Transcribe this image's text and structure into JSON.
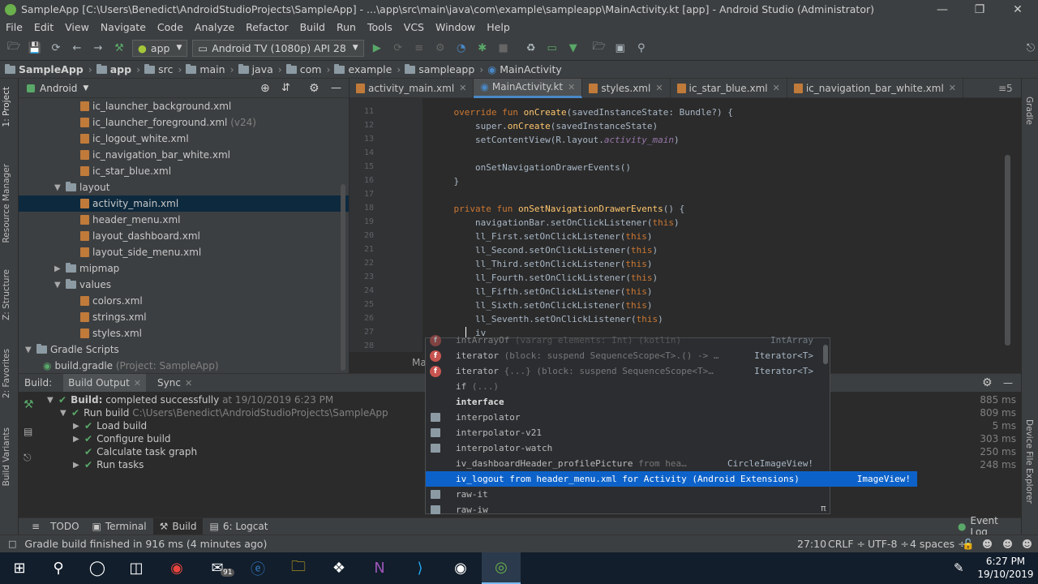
{
  "window": {
    "title": "SampleApp [C:\\Users\\Benedict\\AndroidStudioProjects\\SampleApp] - ...\\app\\src\\main\\java\\com\\example\\sampleapp\\MainActivity.kt [app] - Android Studio (Administrator)"
  },
  "menu": [
    "File",
    "Edit",
    "View",
    "Navigate",
    "Code",
    "Analyze",
    "Refactor",
    "Build",
    "Run",
    "Tools",
    "VCS",
    "Window",
    "Help"
  ],
  "toolbar": {
    "module": "app",
    "device": "Android TV (1080p) API 28"
  },
  "breadcrumb": [
    "SampleApp",
    "app",
    "src",
    "main",
    "java",
    "com",
    "example",
    "sampleapp",
    "MainActivity"
  ],
  "project": {
    "view": "Android",
    "items": [
      {
        "label": "ic_launcher_background.xml",
        "type": "xml",
        "indent": 4
      },
      {
        "label": "ic_launcher_foreground.xml",
        "extra": "(v24)",
        "type": "xml",
        "indent": 4
      },
      {
        "label": "ic_logout_white.xml",
        "type": "xml",
        "indent": 4
      },
      {
        "label": "ic_navigation_bar_white.xml",
        "type": "xml",
        "indent": 4
      },
      {
        "label": "ic_star_blue.xml",
        "type": "xml",
        "indent": 4
      },
      {
        "label": "layout",
        "type": "folder",
        "open": true,
        "indent": 3
      },
      {
        "label": "activity_main.xml",
        "type": "xml",
        "indent": 4,
        "selected": true
      },
      {
        "label": "header_menu.xml",
        "type": "xml",
        "indent": 4
      },
      {
        "label": "layout_dashboard.xml",
        "type": "xml",
        "indent": 4
      },
      {
        "label": "layout_side_menu.xml",
        "type": "xml",
        "indent": 4
      },
      {
        "label": "mipmap",
        "type": "folder",
        "open": false,
        "indent": 3
      },
      {
        "label": "values",
        "type": "folder",
        "open": true,
        "indent": 3
      },
      {
        "label": "colors.xml",
        "type": "xml",
        "indent": 4
      },
      {
        "label": "strings.xml",
        "type": "xml",
        "indent": 4
      },
      {
        "label": "styles.xml",
        "type": "xml",
        "indent": 4
      },
      {
        "label": "Gradle Scripts",
        "type": "gradle",
        "open": true,
        "indent": 1
      },
      {
        "label": "build.gradle",
        "extra": "(Project: SampleApp)",
        "type": "gradlefile",
        "indent": 2
      }
    ]
  },
  "editor_tabs": [
    {
      "label": "activity_main.xml",
      "active": false
    },
    {
      "label": "MainActivity.kt",
      "active": true
    },
    {
      "label": "styles.xml",
      "active": false
    },
    {
      "label": "ic_star_blue.xml",
      "active": false
    },
    {
      "label": "ic_navigation_bar_white.xml",
      "active": false
    }
  ],
  "code_lines": [
    {
      "n": "11",
      "text": "    override fun onCreate(savedInstanceState: Bundle?) {"
    },
    {
      "n": "12",
      "text": "        super.onCreate(savedInstanceState)"
    },
    {
      "n": "13",
      "text": "        setContentView(R.layout.activity_main)"
    },
    {
      "n": "14",
      "text": ""
    },
    {
      "n": "15",
      "text": "        onSetNavigationDrawerEvents()"
    },
    {
      "n": "16",
      "text": "    }"
    },
    {
      "n": "17",
      "text": ""
    },
    {
      "n": "18",
      "text": "    private fun onSetNavigationDrawerEvents() {"
    },
    {
      "n": "19",
      "text": "        navigationBar.setOnClickListener(this)"
    },
    {
      "n": "20",
      "text": "        ll_First.setOnClickListener(this)"
    },
    {
      "n": "21",
      "text": "        ll_Second.setOnClickListener(this)"
    },
    {
      "n": "22",
      "text": "        ll_Third.setOnClickListener(this)"
    },
    {
      "n": "23",
      "text": "        ll_Fourth.setOnClickListener(this)"
    },
    {
      "n": "24",
      "text": "        ll_Fifth.setOnClickListener(this)"
    },
    {
      "n": "25",
      "text": "        ll_Sixth.setOnClickListener(this)"
    },
    {
      "n": "26",
      "text": "        ll_Seventh.setOnClickListener(this)"
    },
    {
      "n": "27",
      "text": "        iv"
    },
    {
      "n": "28",
      "text": ""
    }
  ],
  "editor_breadcrumb": "Ma",
  "completion": [
    {
      "kind": "red",
      "text": "intArrayOf",
      "tail": "(vararg elements: Int) (kotlin)",
      "type": "IntArray"
    },
    {
      "kind": "red",
      "text": "iterator",
      "tail": "(block: suspend SequenceScope<T>.() -> …",
      "type": "Iterator<T>"
    },
    {
      "kind": "red",
      "text": "iterator",
      "tail": "{...} (block: suspend SequenceScope<T>…",
      "type": "Iterator<T>"
    },
    {
      "kind": "none",
      "text": "if",
      "tail": "(...)",
      "type": ""
    },
    {
      "kind": "none",
      "text": "interface",
      "tail": "",
      "type": "",
      "bold": true
    },
    {
      "kind": "folder",
      "text": "interpolator",
      "tail": "",
      "type": ""
    },
    {
      "kind": "folder",
      "text": "interpolator-v21",
      "tail": "",
      "type": ""
    },
    {
      "kind": "folder",
      "text": "interpolator-watch",
      "tail": "",
      "type": ""
    },
    {
      "kind": "none",
      "text": "iv_dashboardHeader_profilePicture",
      "tail": "from hea…",
      "type": "CircleImageView!"
    },
    {
      "kind": "none",
      "text": "iv_logout",
      "tail": "from header_menu.xml for Activity (Android Extensions)",
      "type": "ImageView!",
      "selected": true
    },
    {
      "kind": "folder",
      "text": "raw-it",
      "tail": "",
      "type": ""
    },
    {
      "kind": "folder",
      "text": "raw-iw",
      "tail": "",
      "type": ""
    }
  ],
  "completion_footer": "π",
  "build": {
    "tabs": [
      "Build:",
      "Build Output",
      "Sync"
    ],
    "status_bold": "Build:",
    "status_text": "completed successfully",
    "status_time": "at 19/10/2019 6:23 PM",
    "run_build": "Run build",
    "run_build_path": "C:\\Users\\Benedict\\AndroidStudioProjects\\SampleApp",
    "steps": [
      "Load build",
      "Configure build",
      "Calculate task graph",
      "Run tasks"
    ],
    "timings": [
      "885 ms",
      "809 ms",
      "5 ms",
      "303 ms",
      "250 ms",
      "248 ms"
    ]
  },
  "bottom_tools": [
    "TODO",
    "Terminal",
    "Build",
    "6: Logcat"
  ],
  "event_log": "Event Log",
  "status": {
    "message": "Gradle build finished in 916 ms (4 minutes ago)",
    "position": "27:10",
    "line_sep": "CRLF ÷",
    "encoding": "UTF-8 ÷",
    "indent": "4 spaces ÷"
  },
  "side_tabs_left": [
    "1: Project",
    "Resource Manager",
    "Z: Structure",
    "2: Favorites",
    "Build Variants"
  ],
  "side_tabs_right": [
    "Gradle",
    "Device File Explorer"
  ],
  "taskbar": {
    "time": "6:27 PM",
    "date": "19/10/2019",
    "mail_badge": "91"
  }
}
